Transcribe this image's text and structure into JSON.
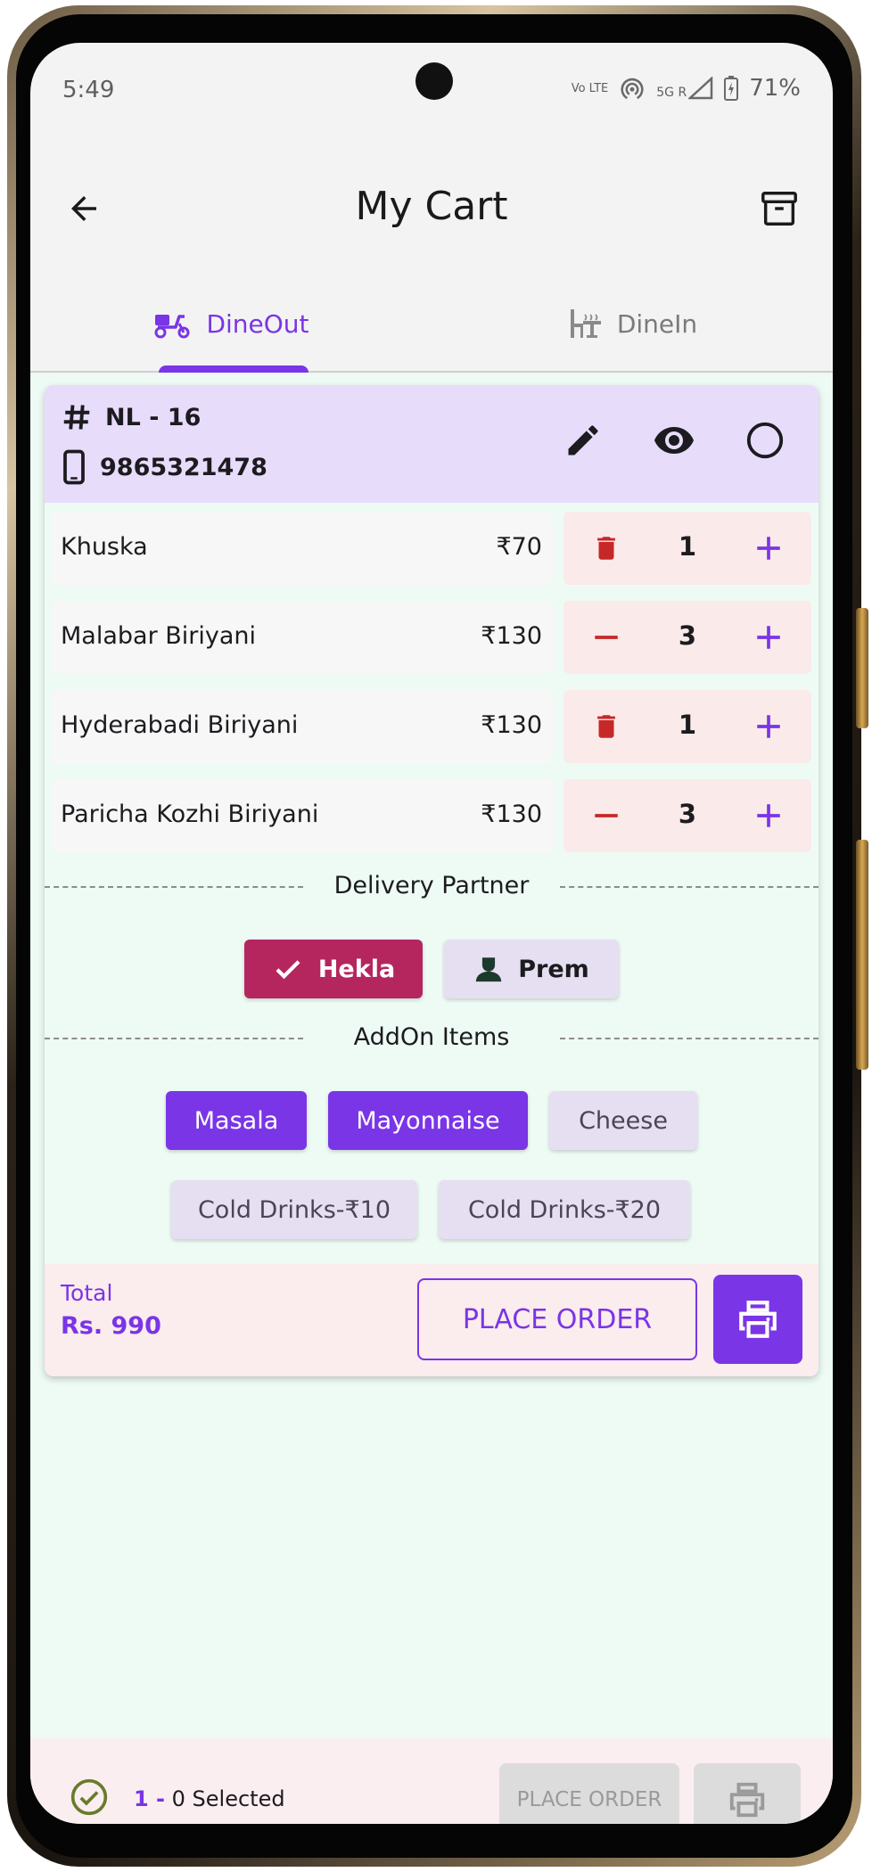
{
  "status_bar": {
    "time": "5:49",
    "battery": "71%",
    "network_labels": [
      "Vo LTE",
      "5G R"
    ]
  },
  "app_bar": {
    "title": "My Cart",
    "back_icon": "arrow-left-icon",
    "archive_icon": "archive-box-icon"
  },
  "tabs": [
    {
      "label": "DineOut",
      "icon": "scooter-icon",
      "selected": true
    },
    {
      "label": "DineIn",
      "icon": "dining-table-icon",
      "selected": false
    }
  ],
  "order": {
    "table": "NL - 16",
    "phone": "9865321478",
    "actions": [
      "edit-icon",
      "eye-icon",
      "circle-select-icon"
    ],
    "items": [
      {
        "name": "Khuska",
        "price": "₹70",
        "qty": "1",
        "left_action": "delete"
      },
      {
        "name": "Malabar Biriyani",
        "price": "₹130",
        "qty": "3",
        "left_action": "minus"
      },
      {
        "name": "Hyderabadi Biriyani",
        "price": "₹130",
        "qty": "1",
        "left_action": "delete"
      },
      {
        "name": "Paricha Kozhi Biriyani",
        "price": "₹130",
        "qty": "3",
        "left_action": "minus"
      }
    ],
    "delivery_partner_heading": "Delivery Partner",
    "partners": [
      {
        "name": "Hekla",
        "selected": true
      },
      {
        "name": "Prem",
        "selected": false
      }
    ],
    "addon_heading": "AddOn Items",
    "addons": [
      {
        "name": "Masala",
        "selected": true
      },
      {
        "name": "Mayonnaise",
        "selected": true
      },
      {
        "name": "Cheese",
        "selected": false
      },
      {
        "name": "Cold Drinks-₹10",
        "selected": false
      },
      {
        "name": "Cold Drinks-₹20",
        "selected": false
      }
    ],
    "total_label": "Total",
    "total_amount": "Rs. 990",
    "place_order_label": "PLACE ORDER"
  },
  "bottom_bar": {
    "selected_count": "1 -",
    "selected_text": " 0 Selected",
    "place_order_label": "PLACE ORDER"
  },
  "colors": {
    "accent": "#7a35e6",
    "partner_selected": "#b5265e",
    "delete": "#c62828",
    "header_bg": "#e8dcfb",
    "content_bg": "#eefbf5"
  }
}
